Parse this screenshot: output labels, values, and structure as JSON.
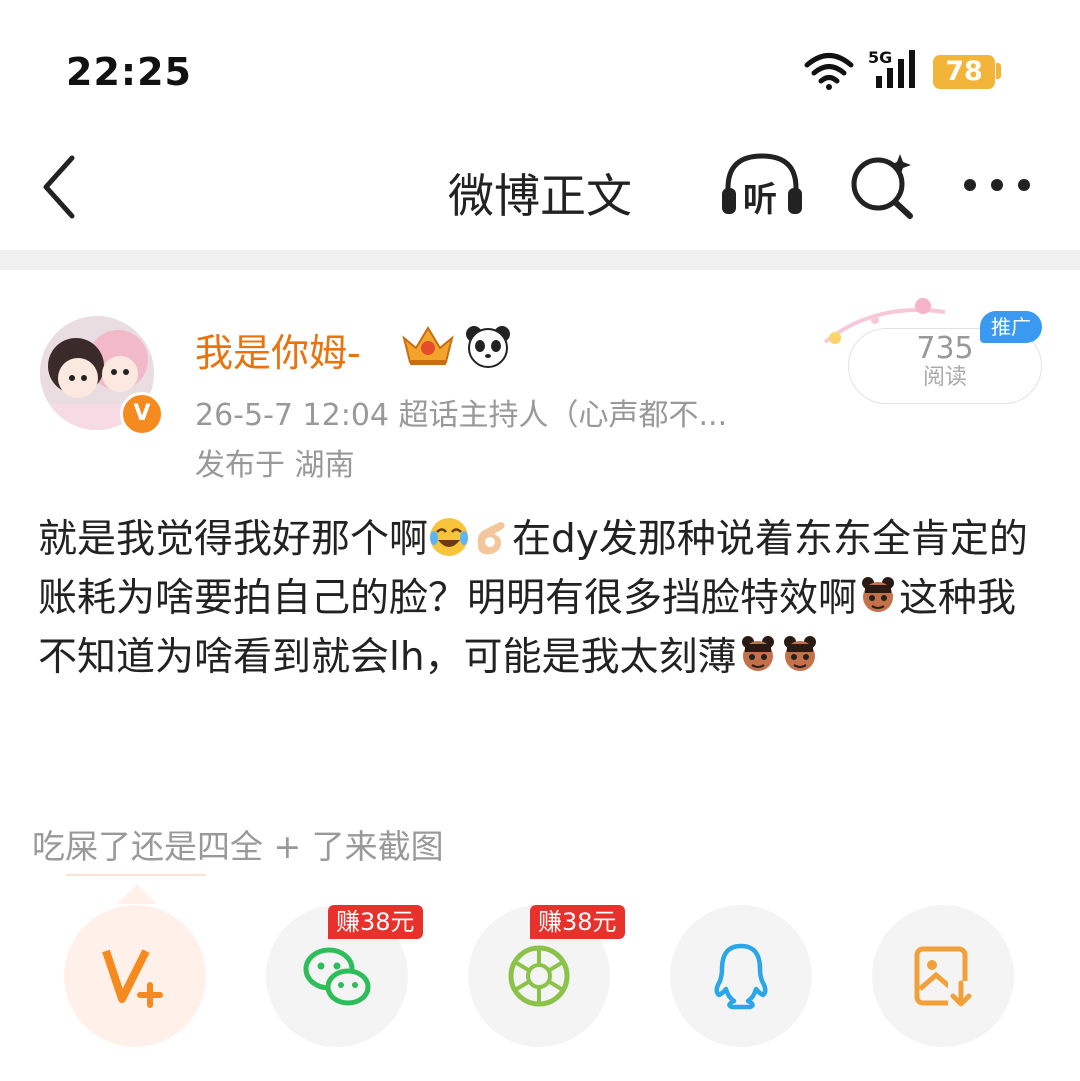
{
  "status_bar": {
    "time": "22:25",
    "network": "5G",
    "battery": "78"
  },
  "nav": {
    "title": "微博正文",
    "listen_label": "听"
  },
  "post": {
    "username": "我是你姆-",
    "meta": "26-5-7 12:04  超话主持人（心声都不...",
    "location": "发布于 湖南",
    "reads_count": "735",
    "reads_label": "阅读",
    "promo_label": "推广",
    "text_parts": [
      "就是我觉得我好那个啊",
      "在dy发那种说着东东全肯定的账耗为啥要拍自己的脸？明明有很多挡脸特效啊",
      "这种我不知道为啥看到就会lh，可能是我太刻薄"
    ]
  },
  "comment_preview": "吃屎了还是四全 + 了来截图",
  "share": {
    "wechat_badge": "赚38元",
    "moments_badge": "赚38元"
  },
  "colors": {
    "accent": "#e8730f",
    "wechat": "#2dbd5a",
    "qq": "#2ba6e8",
    "badge": "#e8312b"
  }
}
